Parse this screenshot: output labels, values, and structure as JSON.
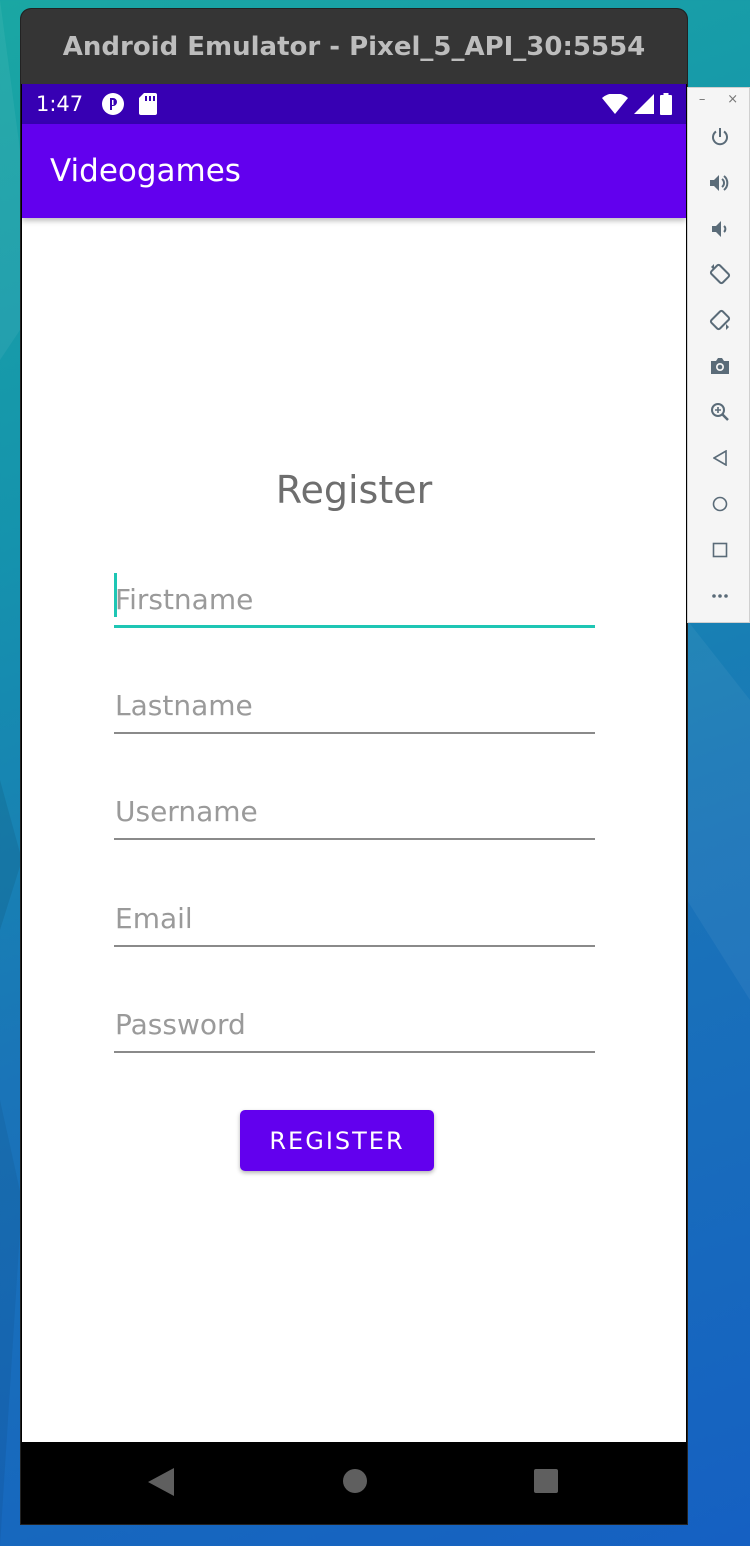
{
  "window": {
    "title": "Android Emulator - Pixel_5_API_30:5554"
  },
  "status_bar": {
    "time": "1:47",
    "left_icons": [
      "sync-icon",
      "sd-card-icon"
    ],
    "right_icons": [
      "wifi-icon",
      "cell-signal-icon",
      "battery-icon"
    ],
    "color": "#3700b3"
  },
  "app_bar": {
    "title": "Videogames",
    "color": "#6200ee"
  },
  "form": {
    "title": "Register",
    "fields": [
      {
        "name": "firstname",
        "placeholder": "Firstname",
        "value": "",
        "focused": true
      },
      {
        "name": "lastname",
        "placeholder": "Lastname",
        "value": "",
        "focused": false
      },
      {
        "name": "username",
        "placeholder": "Username",
        "value": "",
        "focused": false
      },
      {
        "name": "email",
        "placeholder": "Email",
        "value": "",
        "focused": false
      },
      {
        "name": "password",
        "placeholder": "Password",
        "value": "",
        "focused": false
      }
    ],
    "accent_color": "#1ec6b4",
    "submit_label": "REGISTER"
  },
  "nav_bar": {
    "buttons": [
      "back-icon",
      "home-icon",
      "recents-icon"
    ]
  },
  "side_panel": {
    "window_controls": [
      "minimize-icon",
      "close-icon"
    ],
    "tools": [
      "power-icon",
      "volume-up-icon",
      "volume-down-icon",
      "rotate-left-icon",
      "rotate-right-icon",
      "camera-icon",
      "zoom-icon",
      "back-icon",
      "home-icon",
      "overview-icon",
      "more-icon"
    ],
    "minimize_glyph": "–",
    "close_glyph": "×"
  }
}
